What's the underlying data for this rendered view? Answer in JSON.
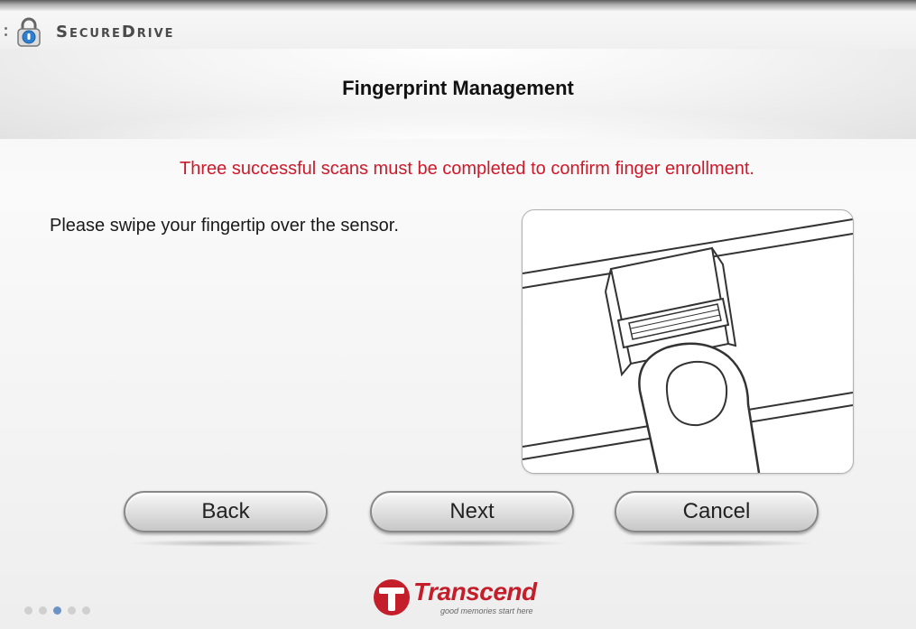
{
  "app": {
    "brand": "SecureDrive"
  },
  "header": {
    "title": "Fingerprint Management"
  },
  "main": {
    "notice": "Three successful scans must be completed to confirm finger enrollment.",
    "instruction": "Please swipe your fingertip over the sensor."
  },
  "buttons": {
    "back": "Back",
    "next": "Next",
    "cancel": "Cancel"
  },
  "footer": {
    "progress_steps": 5,
    "current_step": 3,
    "logo_text": "Transcend",
    "logo_tagline": "good memories start here"
  },
  "colors": {
    "notice": "#cc1a2a",
    "logo": "#c41e2a",
    "active_step": "#6b93c8"
  },
  "icons": [
    "lock-icon",
    "fingerprint-sensor-illustration",
    "transcend-logo-icon"
  ]
}
